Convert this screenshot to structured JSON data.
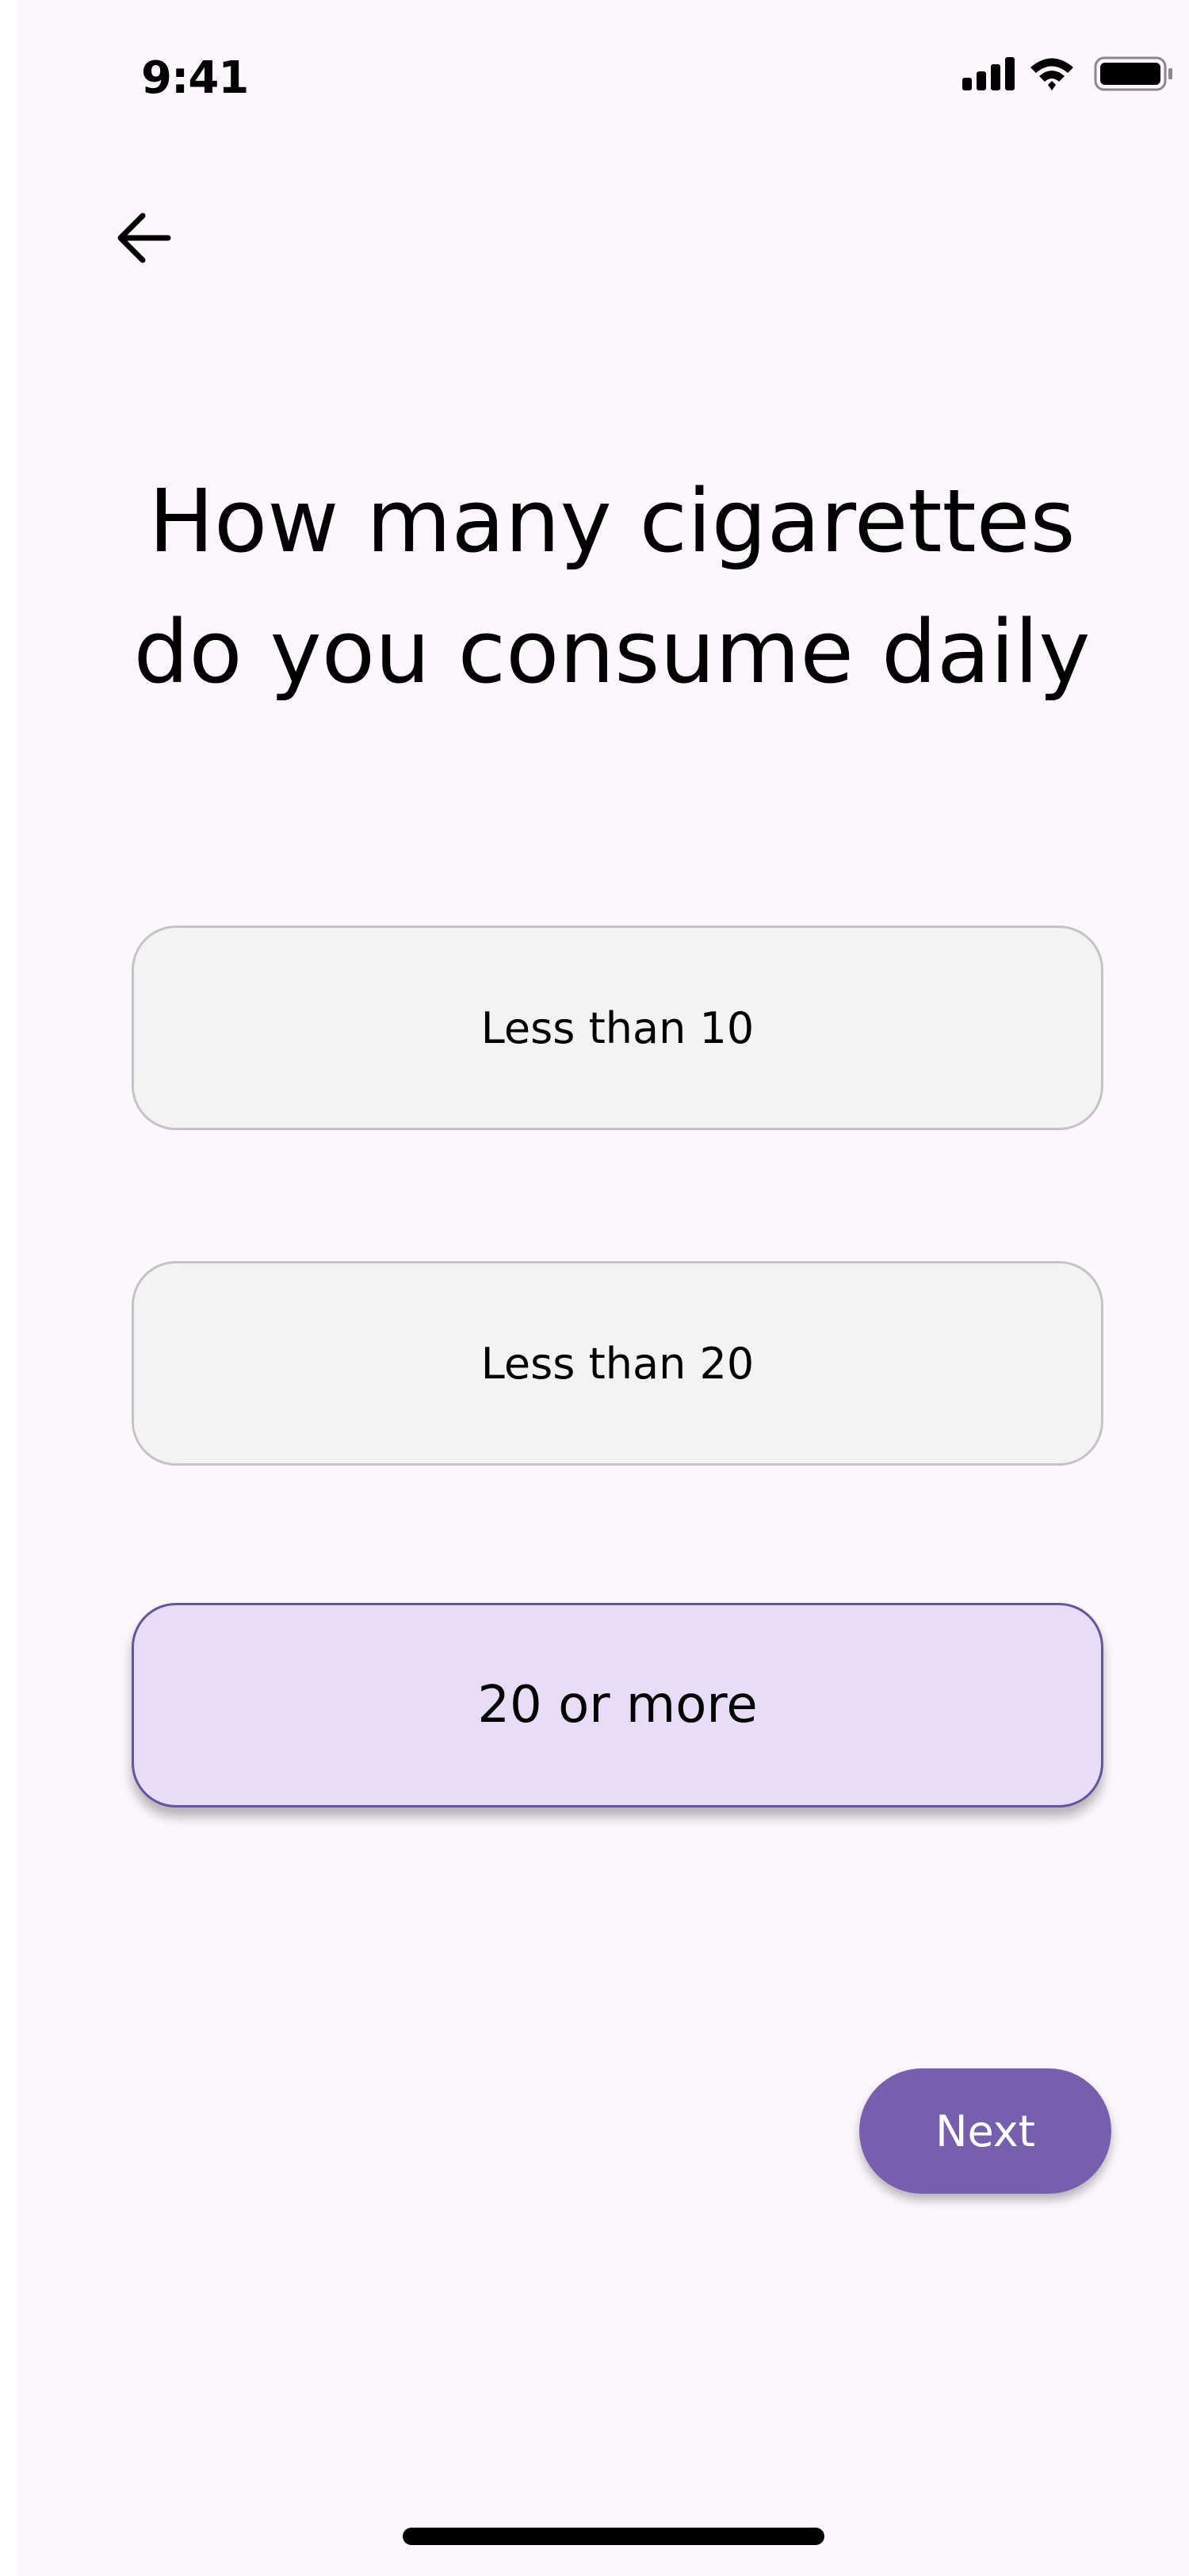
{
  "status_bar": {
    "time": "9:41",
    "icons": [
      "cellular-signal-icon",
      "wifi-icon",
      "battery-icon"
    ]
  },
  "nav": {
    "back_icon": "arrow-left-icon"
  },
  "question": {
    "line1": "How many cigarettes",
    "line2": "do you consume daily"
  },
  "options": [
    {
      "label": "Less than 10",
      "selected": false
    },
    {
      "label": "Less than 20",
      "selected": false
    },
    {
      "label": "20 or more",
      "selected": true
    }
  ],
  "actions": {
    "next_label": "Next"
  },
  "colors": {
    "background": "#fcf7fc",
    "option_background": "#f3f3f3",
    "option_border": "#c4c4c4",
    "selected_background": "#e7ddf6",
    "selected_border": "#64559c",
    "accent": "#7660ae"
  }
}
